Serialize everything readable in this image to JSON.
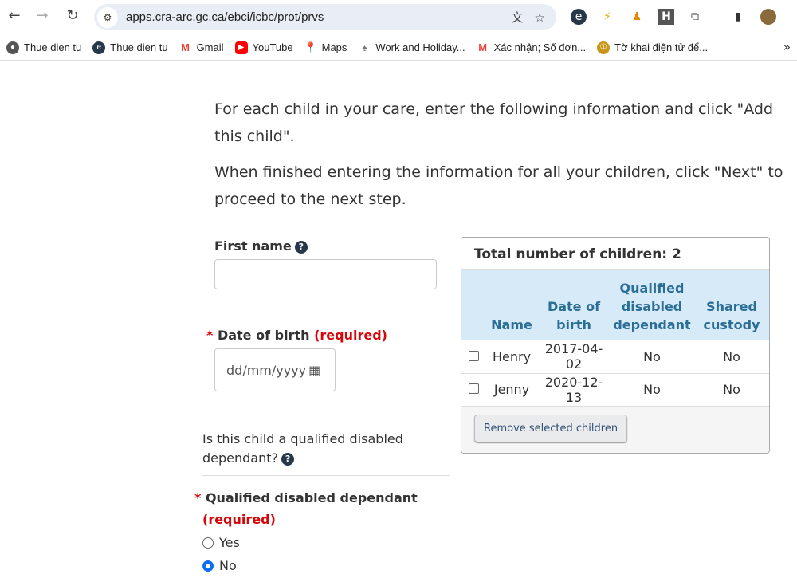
{
  "browser": {
    "url": "apps.cra-arc.gc.ca/ebci/icbc/prot/prvs",
    "bookmarks": [
      {
        "label": "Thue dien tu",
        "color": "#555"
      },
      {
        "label": "Thue dien tu",
        "color": "#26374a"
      },
      {
        "label": "Gmail",
        "color": "#ea4335"
      },
      {
        "label": "YouTube",
        "color": "#ff0000"
      },
      {
        "label": "Maps",
        "color": "#34a853"
      },
      {
        "label": "Work and Holiday...",
        "color": "#777"
      },
      {
        "label": "Xác nhận; Số đơn...",
        "color": "#ea4335"
      },
      {
        "label": "Tờ khai điện tử để...",
        "color": "#c8961a"
      }
    ]
  },
  "page": {
    "intro1": "For each child in your care, enter the following information and click \"Add this child\".",
    "intro2": "When finished entering the information for all your children, click \"Next\" to proceed to the next step.",
    "first_name_label": "First name",
    "first_name_value": "",
    "dob_label": "Date of birth",
    "required": "(required)",
    "dob_placeholder": "dd/mm/yyyy",
    "disabled_question": "Is this child a qualified disabled dependant?",
    "qdd_label": "Qualified disabled dependant",
    "options": [
      {
        "label": "Yes",
        "selected": false
      },
      {
        "label": "No",
        "selected": true
      }
    ]
  },
  "children": {
    "title": "Total number of children: 2",
    "headers": [
      "Name",
      "Date of birth",
      "Qualified disabled dependant",
      "Shared custody"
    ],
    "rows": [
      {
        "name": "Henry",
        "dob": "2017-04-02",
        "qdd": "No",
        "shared": "No"
      },
      {
        "name": "Jenny",
        "dob": "2020-12-13",
        "qdd": "No",
        "shared": "No"
      }
    ],
    "remove_label": "Remove selected children"
  }
}
